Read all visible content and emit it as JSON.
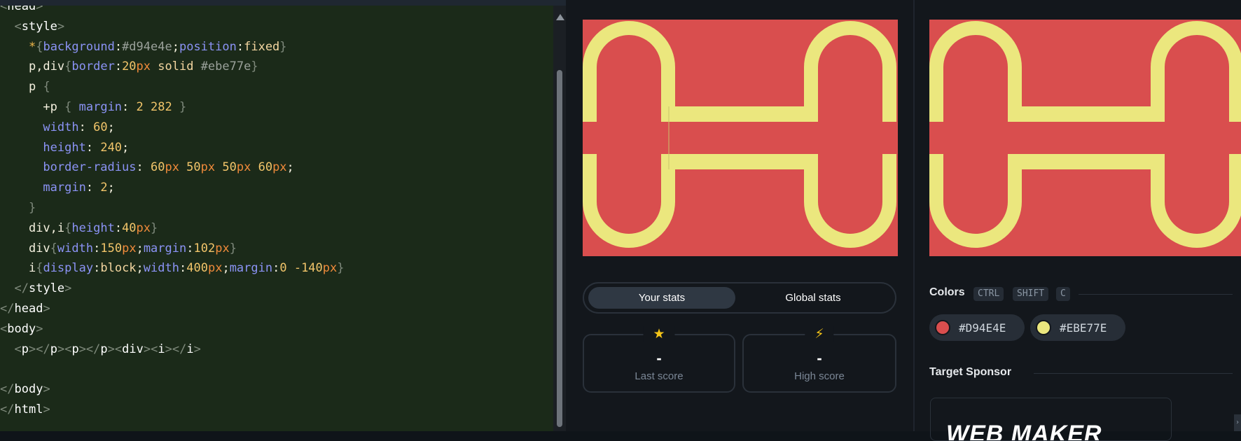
{
  "editor": {
    "lines": [
      [
        [
          "t-br",
          "<"
        ],
        [
          "t-tag",
          "head"
        ],
        [
          "t-br",
          ">"
        ]
      ],
      [
        [
          "",
          "  "
        ],
        [
          "t-br",
          "<"
        ],
        [
          "t-tag",
          "style"
        ],
        [
          "t-br",
          ">"
        ]
      ],
      [
        [
          "",
          "    "
        ],
        [
          "t-star",
          "*"
        ],
        [
          "t-br",
          "{"
        ],
        [
          "t-prop",
          "background"
        ],
        [
          "t-sel",
          ":"
        ],
        [
          "t-hash",
          "#d94e4e"
        ],
        [
          "t-sel",
          ";"
        ],
        [
          "t-prop",
          "position"
        ],
        [
          "t-sel",
          ":"
        ],
        [
          "t-kw",
          "fixed"
        ],
        [
          "t-br",
          "}"
        ]
      ],
      [
        [
          "",
          "    "
        ],
        [
          "t-sel",
          "p,div"
        ],
        [
          "t-br",
          "{"
        ],
        [
          "t-prop",
          "border"
        ],
        [
          "t-sel",
          ":"
        ],
        [
          "t-val",
          "20"
        ],
        [
          "t-unit",
          "px"
        ],
        [
          "t-kw",
          " solid "
        ],
        [
          "t-hash",
          "#ebe77e"
        ],
        [
          "t-br",
          "}"
        ]
      ],
      [
        [
          "",
          "    "
        ],
        [
          "t-sel",
          "p "
        ],
        [
          "t-br",
          "{"
        ]
      ],
      [
        [
          "",
          "      "
        ],
        [
          "t-sel",
          "+p "
        ],
        [
          "t-br",
          "{ "
        ],
        [
          "t-prop",
          "margin"
        ],
        [
          "t-sel",
          ": "
        ],
        [
          "t-val",
          "2 282 "
        ],
        [
          "t-br",
          "}"
        ]
      ],
      [
        [
          "",
          "      "
        ],
        [
          "t-prop",
          "width"
        ],
        [
          "t-sel",
          ": "
        ],
        [
          "t-val",
          "60"
        ],
        [
          "t-sel",
          ";"
        ]
      ],
      [
        [
          "",
          "      "
        ],
        [
          "t-prop",
          "height"
        ],
        [
          "t-sel",
          ": "
        ],
        [
          "t-val",
          "240"
        ],
        [
          "t-sel",
          ";"
        ]
      ],
      [
        [
          "",
          "      "
        ],
        [
          "t-prop",
          "border-radius"
        ],
        [
          "t-sel",
          ": "
        ],
        [
          "t-val",
          "60"
        ],
        [
          "t-unit",
          "px "
        ],
        [
          "t-val",
          "50"
        ],
        [
          "t-unit",
          "px "
        ],
        [
          "t-val",
          "50"
        ],
        [
          "t-unit",
          "px "
        ],
        [
          "t-val",
          "60"
        ],
        [
          "t-unit",
          "px"
        ],
        [
          "t-sel",
          ";"
        ]
      ],
      [
        [
          "",
          "      "
        ],
        [
          "t-prop",
          "margin"
        ],
        [
          "t-sel",
          ": "
        ],
        [
          "t-val",
          "2"
        ],
        [
          "t-sel",
          ";"
        ]
      ],
      [
        [
          "",
          "    "
        ],
        [
          "t-br",
          "}"
        ]
      ],
      [
        [
          "",
          "    "
        ],
        [
          "t-sel",
          "div,i"
        ],
        [
          "t-br",
          "{"
        ],
        [
          "t-prop",
          "height"
        ],
        [
          "t-sel",
          ":"
        ],
        [
          "t-val",
          "40"
        ],
        [
          "t-unit",
          "px"
        ],
        [
          "t-br",
          "}"
        ]
      ],
      [
        [
          "",
          "    "
        ],
        [
          "t-sel",
          "div"
        ],
        [
          "t-br",
          "{"
        ],
        [
          "t-prop",
          "width"
        ],
        [
          "t-sel",
          ":"
        ],
        [
          "t-val",
          "150"
        ],
        [
          "t-unit",
          "px"
        ],
        [
          "t-sel",
          ";"
        ],
        [
          "t-prop",
          "margin"
        ],
        [
          "t-sel",
          ":"
        ],
        [
          "t-val",
          "102"
        ],
        [
          "t-unit",
          "px"
        ],
        [
          "t-br",
          "}"
        ]
      ],
      [
        [
          "",
          "    "
        ],
        [
          "t-sel",
          "i"
        ],
        [
          "t-br",
          "{"
        ],
        [
          "t-prop",
          "display"
        ],
        [
          "t-sel",
          ":"
        ],
        [
          "t-kw",
          "block"
        ],
        [
          "t-sel",
          ";"
        ],
        [
          "t-prop",
          "width"
        ],
        [
          "t-sel",
          ":"
        ],
        [
          "t-val",
          "400"
        ],
        [
          "t-unit",
          "px"
        ],
        [
          "t-sel",
          ";"
        ],
        [
          "t-prop",
          "margin"
        ],
        [
          "t-sel",
          ":"
        ],
        [
          "t-val",
          "0 -140"
        ],
        [
          "t-unit",
          "px"
        ],
        [
          "t-br",
          "}"
        ]
      ],
      [
        [
          "",
          "  "
        ],
        [
          "t-br",
          "</"
        ],
        [
          "t-tag",
          "style"
        ],
        [
          "t-br",
          ">"
        ]
      ],
      [
        [
          "t-br",
          "</"
        ],
        [
          "t-tag",
          "head"
        ],
        [
          "t-br",
          ">"
        ]
      ],
      [
        [
          "t-br",
          "<"
        ],
        [
          "t-tag",
          "body"
        ],
        [
          "t-br",
          ">"
        ]
      ],
      [
        [
          "",
          "  "
        ],
        [
          "t-br",
          "<"
        ],
        [
          "t-tag",
          "p"
        ],
        [
          "t-br",
          "></"
        ],
        [
          "t-tag",
          "p"
        ],
        [
          "t-br",
          "><"
        ],
        [
          "t-tag",
          "p"
        ],
        [
          "t-br",
          "></"
        ],
        [
          "t-tag",
          "p"
        ],
        [
          "t-br",
          "><"
        ],
        [
          "t-tag",
          "div"
        ],
        [
          "t-br",
          "><"
        ],
        [
          "t-tag",
          "i"
        ],
        [
          "t-br",
          "></"
        ],
        [
          "t-tag",
          "i"
        ],
        [
          "t-br",
          ">"
        ]
      ],
      [],
      [
        [
          "t-br",
          "</"
        ],
        [
          "t-tag",
          "body"
        ],
        [
          "t-br",
          ">"
        ]
      ],
      [
        [
          "t-br",
          "</"
        ],
        [
          "t-tag",
          "html"
        ],
        [
          "t-br",
          ">"
        ]
      ]
    ]
  },
  "stats": {
    "tab_yours": "Your stats",
    "tab_global": "Global stats",
    "last_score_value": "-",
    "last_score_label": "Last score",
    "high_score_value": "-",
    "high_score_label": "High score",
    "star_icon": "★",
    "bolt_icon": "⚡"
  },
  "colors": {
    "title": "Colors",
    "shortcut": [
      "CTRL",
      "SHIFT",
      "C"
    ],
    "swatches": [
      {
        "hex": "#D94E4E",
        "value": "#d94e4e"
      },
      {
        "hex": "#EBE77E",
        "value": "#ebe77e"
      }
    ]
  },
  "sponsor": {
    "title": "Target Sponsor",
    "logo_text": "WEB MAKER"
  },
  "theme": {
    "target_bg": "#d94e4e",
    "target_fg": "#ebe77e",
    "star_color": "#f5c518",
    "bolt_color": "#f5c518"
  }
}
